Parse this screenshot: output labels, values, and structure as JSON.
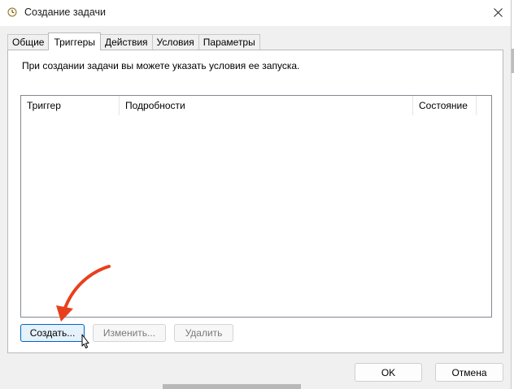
{
  "window": {
    "title": "Создание задачи",
    "icons": {
      "title": "clock-icon",
      "close": "close-icon"
    }
  },
  "tabs": [
    {
      "label": "Общие",
      "active": false
    },
    {
      "label": "Триггеры",
      "active": true
    },
    {
      "label": "Действия",
      "active": false
    },
    {
      "label": "Условия",
      "active": false
    },
    {
      "label": "Параметры",
      "active": false
    }
  ],
  "triggers": {
    "instruction": "При создании задачи вы можете указать условия ее запуска.",
    "columns": [
      "Триггер",
      "Подробности",
      "Состояние"
    ],
    "rows": [],
    "buttons": {
      "create": "Создать...",
      "edit": "Изменить...",
      "delete": "Удалить"
    }
  },
  "footer": {
    "ok": "OK",
    "cancel": "Отмена"
  },
  "colors": {
    "accent": "#0067c0",
    "annotation_arrow": "#e8401c"
  }
}
